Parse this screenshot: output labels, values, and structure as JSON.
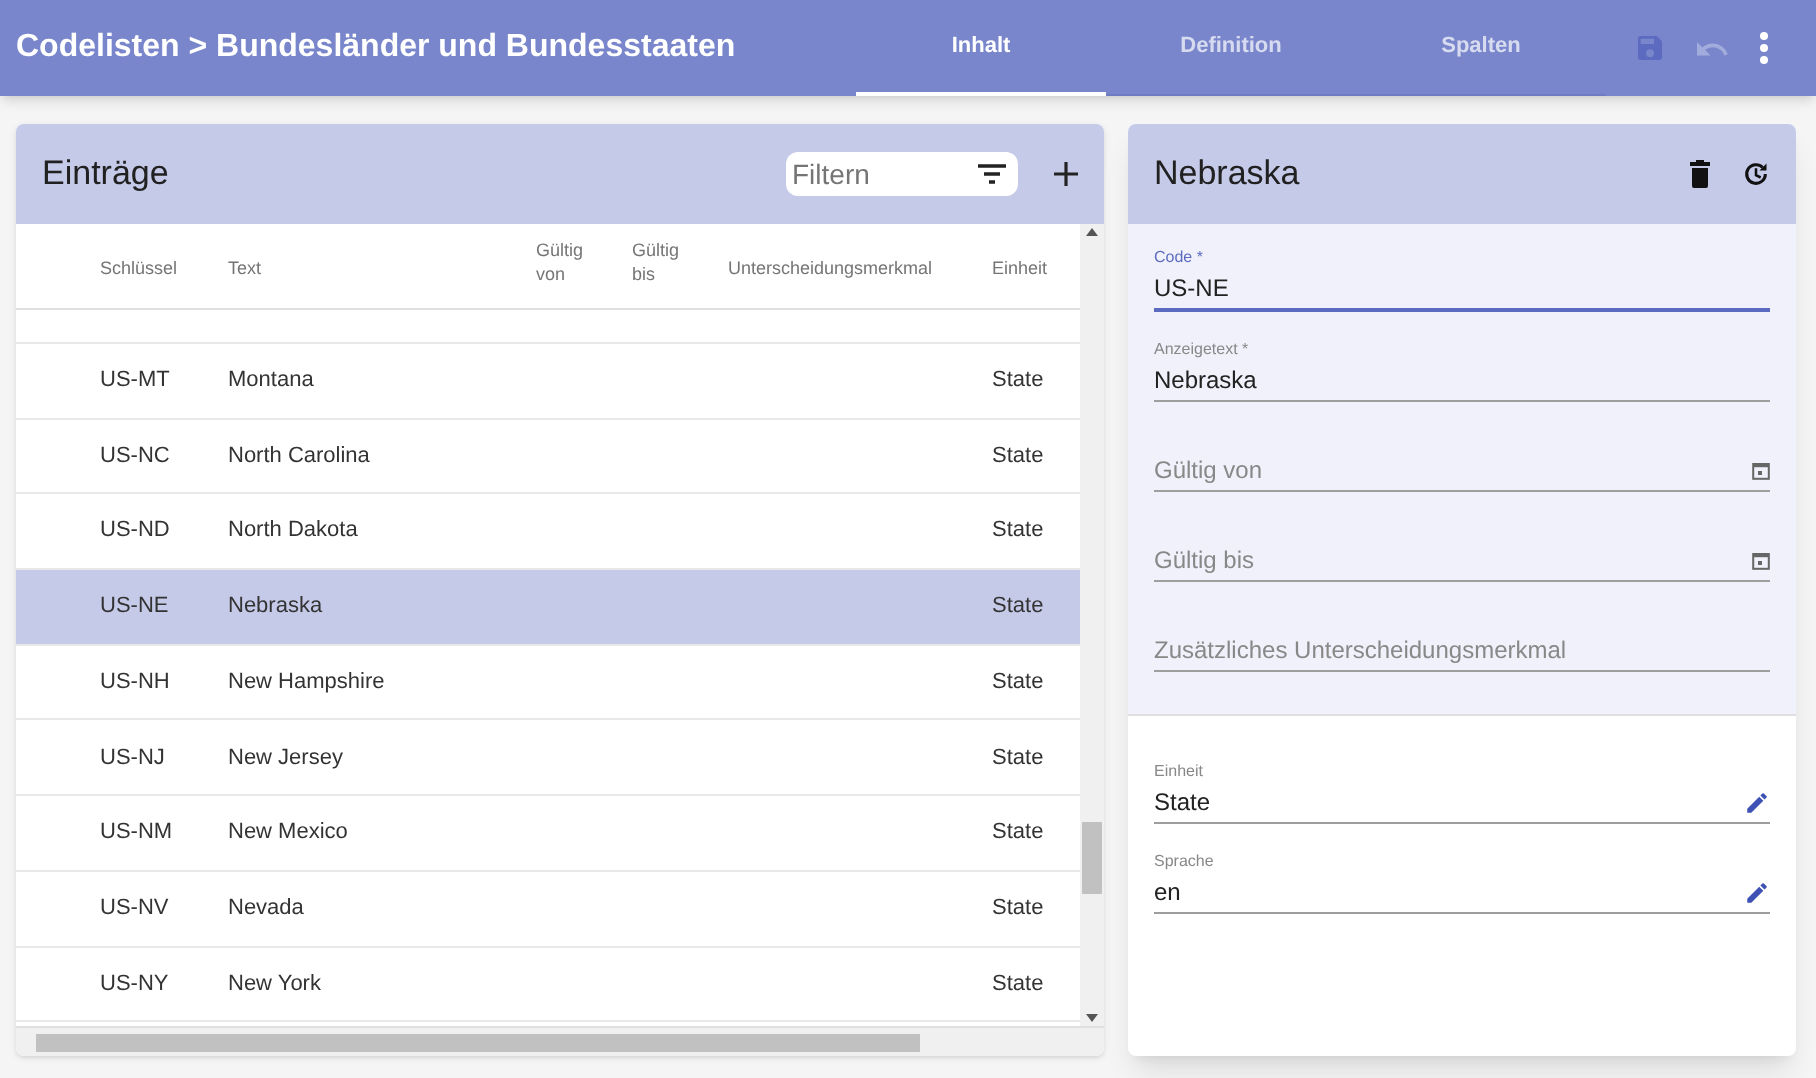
{
  "app_bar": {
    "title": "Codelisten > Bundesländer und Bundesstaaten",
    "tabs": [
      {
        "label": "Inhalt",
        "selected": true
      },
      {
        "label": "Definition",
        "selected": false
      },
      {
        "label": "Spalten",
        "selected": false
      }
    ]
  },
  "entries": {
    "title": "Einträge",
    "filter": {
      "placeholder": "Filtern"
    },
    "columns": [
      "Schlüssel",
      "Text",
      "Gültig von",
      "Gültig bis",
      "Unterscheidungsmerkmal",
      "Einheit"
    ],
    "rows": [
      {
        "key": "US-MT",
        "text": "Montana",
        "unit": "State",
        "selected": false
      },
      {
        "key": "US-NC",
        "text": "North Carolina",
        "unit": "State",
        "selected": false
      },
      {
        "key": "US-ND",
        "text": "North Dakota",
        "unit": "State",
        "selected": false
      },
      {
        "key": "US-NE",
        "text": "Nebraska",
        "unit": "State",
        "selected": true
      },
      {
        "key": "US-NH",
        "text": "New Hampshire",
        "unit": "State",
        "selected": false
      },
      {
        "key": "US-NJ",
        "text": "New Jersey",
        "unit": "State",
        "selected": false
      },
      {
        "key": "US-NM",
        "text": "New Mexico",
        "unit": "State",
        "selected": false
      },
      {
        "key": "US-NV",
        "text": "Nevada",
        "unit": "State",
        "selected": false
      },
      {
        "key": "US-NY",
        "text": "New York",
        "unit": "State",
        "selected": false
      }
    ]
  },
  "detail": {
    "title": "Nebraska",
    "fields": [
      {
        "kind": "text",
        "label": "Code *",
        "value": "US-NE",
        "focused": true
      },
      {
        "kind": "text",
        "label": "Anzeigetext *",
        "value": "Nebraska",
        "focused": false
      },
      {
        "kind": "date",
        "placeholder": "Gültig von"
      },
      {
        "kind": "date",
        "placeholder": "Gültig bis"
      },
      {
        "kind": "text",
        "placeholder": "Zusätzliches Unterscheidungsmerkmal",
        "focused": false
      }
    ],
    "linked_fields": [
      {
        "label": "Einheit",
        "value": "State"
      },
      {
        "label": "Sprache",
        "value": "en"
      }
    ]
  }
}
